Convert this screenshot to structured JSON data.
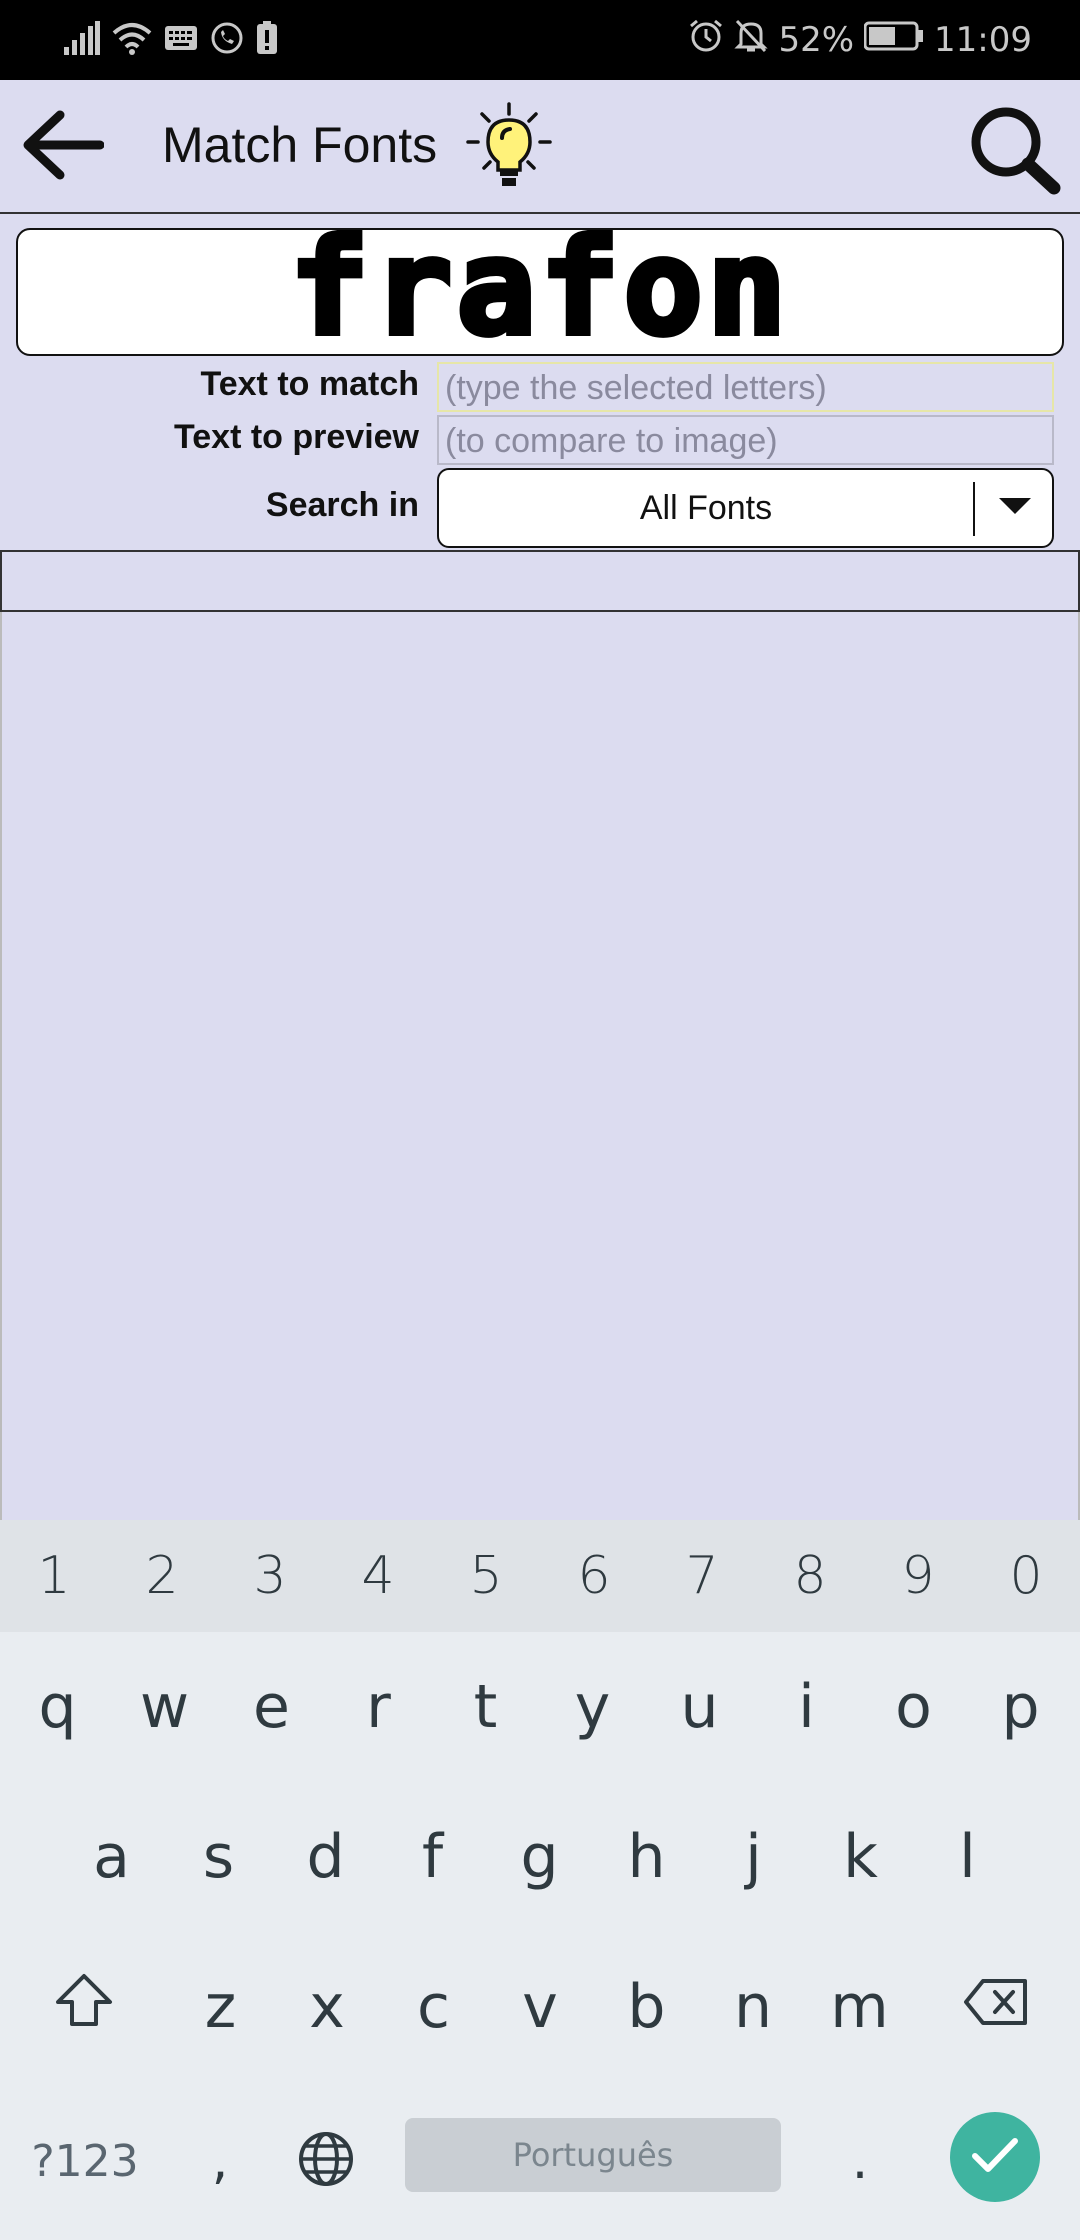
{
  "status_bar": {
    "battery_percent": "52%",
    "time": "11:09",
    "icons_left": [
      "signal-icon",
      "wifi-icon",
      "keyboard-icon",
      "whatsapp-icon",
      "alert-icon"
    ],
    "icons_right": [
      "alarm-icon",
      "silent-icon",
      "battery-icon"
    ]
  },
  "app_bar": {
    "title": "Match Fonts",
    "icons": [
      "back-arrow-icon",
      "lightbulb-icon",
      "search-icon"
    ]
  },
  "image_sample": {
    "text": "frafon"
  },
  "form": {
    "text_to_match": {
      "label": "Text to match",
      "value": "",
      "placeholder": "(type the selected letters)"
    },
    "text_to_preview": {
      "label": "Text to preview",
      "value": "",
      "placeholder": "(to compare to image)"
    },
    "search_in": {
      "label": "Search in",
      "selected": "All Fonts"
    }
  },
  "keyboard": {
    "numbers": [
      "1",
      "2",
      "3",
      "4",
      "5",
      "6",
      "7",
      "8",
      "9",
      "0"
    ],
    "row1": [
      "q",
      "w",
      "e",
      "r",
      "t",
      "y",
      "u",
      "i",
      "o",
      "p"
    ],
    "row2": [
      "a",
      "s",
      "d",
      "f",
      "g",
      "h",
      "j",
      "k",
      "l"
    ],
    "row3": [
      "z",
      "x",
      "c",
      "v",
      "b",
      "n",
      "m"
    ],
    "symbols_key": "?123",
    "comma": ",",
    "space_label": "Português",
    "period": "."
  },
  "colors": {
    "background": "#dcdcf0",
    "status_bar": "#000000",
    "enter_key": "#3fb4a0",
    "bulb": "#fff27a"
  }
}
